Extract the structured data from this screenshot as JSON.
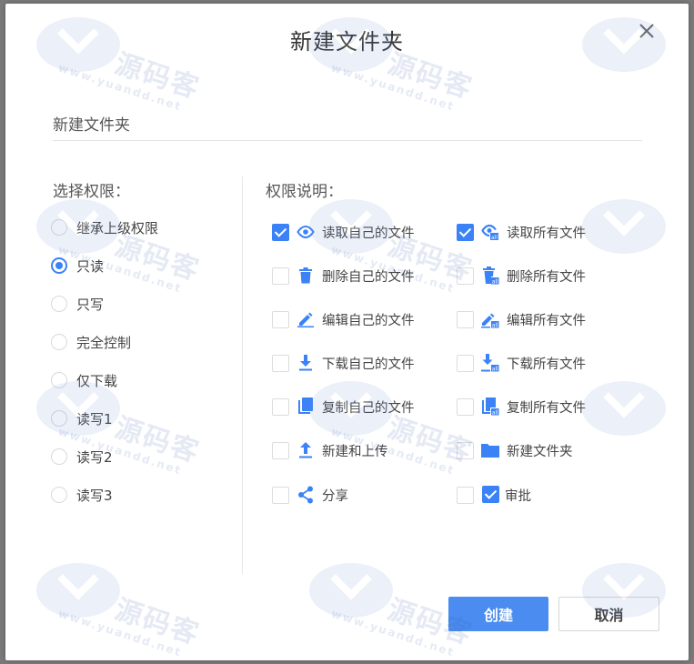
{
  "dialog": {
    "title": "新建文件夹",
    "name_input_value": "新建文件夹"
  },
  "left": {
    "label": "选择权限：",
    "options": [
      {
        "label": "继承上级权限",
        "checked": false
      },
      {
        "label": "只读",
        "checked": true
      },
      {
        "label": "只写",
        "checked": false
      },
      {
        "label": "完全控制",
        "checked": false
      },
      {
        "label": "仅下载",
        "checked": false
      },
      {
        "label": "读写1",
        "checked": false
      },
      {
        "label": "读写2",
        "checked": false
      },
      {
        "label": "读写3",
        "checked": false
      }
    ]
  },
  "right": {
    "label": "权限说明：",
    "permissions": [
      {
        "label": "读取自己的文件",
        "checked": true,
        "icon": "eye-icon"
      },
      {
        "label": "读取所有文件",
        "checked": true,
        "icon": "eye-all-icon"
      },
      {
        "label": "删除自己的文件",
        "checked": false,
        "icon": "trash-icon"
      },
      {
        "label": "删除所有文件",
        "checked": false,
        "icon": "trash-all-icon"
      },
      {
        "label": "编辑自己的文件",
        "checked": false,
        "icon": "pencil-icon"
      },
      {
        "label": "编辑所有文件",
        "checked": false,
        "icon": "pencil-all-icon"
      },
      {
        "label": "下载自己的文件",
        "checked": false,
        "icon": "download-icon"
      },
      {
        "label": "下载所有文件",
        "checked": false,
        "icon": "download-all-icon"
      },
      {
        "label": "复制自己的文件",
        "checked": false,
        "icon": "copy-icon"
      },
      {
        "label": "复制所有文件",
        "checked": false,
        "icon": "copy-all-icon"
      },
      {
        "label": "新建和上传",
        "checked": false,
        "icon": "upload-icon"
      },
      {
        "label": "新建文件夹",
        "checked": false,
        "icon": "folder-icon"
      },
      {
        "label": "分享",
        "checked": false,
        "icon": "share-icon"
      },
      {
        "label": "审批",
        "checked": true,
        "icon": "approve-icon"
      }
    ]
  },
  "buttons": {
    "create": "创建",
    "cancel": "取消"
  },
  "watermark": {
    "brand": "源码客",
    "url": "www.yuandd.net"
  },
  "colors": {
    "accent": "#3b82f6",
    "primary_button": "#4a8cf0"
  }
}
